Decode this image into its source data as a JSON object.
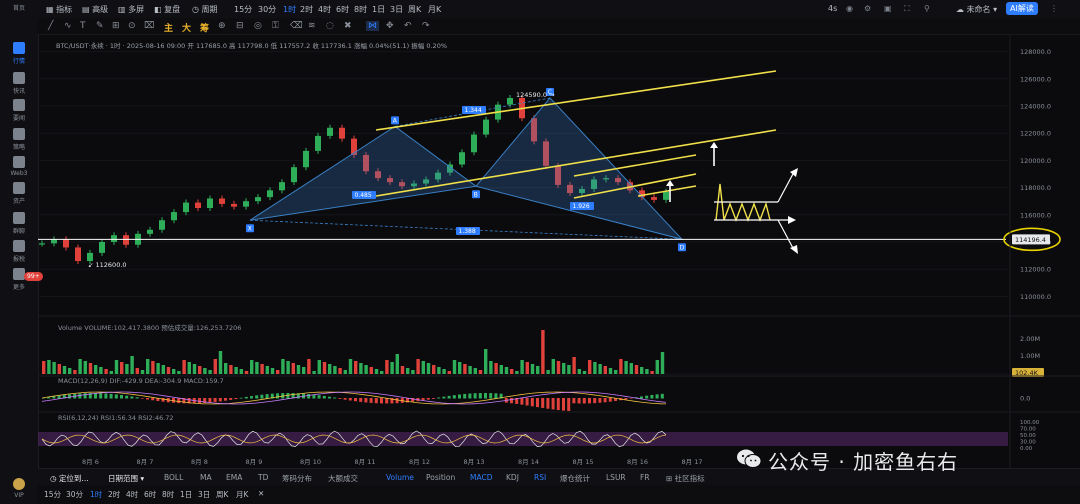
{
  "sidebar": {
    "top_label": "首页",
    "items": [
      {
        "label": "行情",
        "icon": "chart-bars-icon",
        "active": true
      },
      {
        "label": "快讯",
        "icon": "newsflash-icon"
      },
      {
        "label": "要闻",
        "icon": "news-icon"
      },
      {
        "label": "策略",
        "icon": "strategy-icon"
      },
      {
        "label": "Web3",
        "icon": "web3-icon"
      },
      {
        "label": "资产",
        "icon": "wallet-icon"
      },
      {
        "label": "群聊",
        "icon": "chat-icon"
      },
      {
        "label": "报税",
        "icon": "tax-icon"
      },
      {
        "label": "更多",
        "icon": "more-grid-icon"
      }
    ],
    "badge": "99+",
    "bottom_label": "VIP"
  },
  "toolbar": {
    "indicator": "指标",
    "advanced": "高级",
    "multi": "多屏",
    "replay": "复盘",
    "period": "周期",
    "timeframes": [
      "15分",
      "30分",
      "1时",
      "2时",
      "4时",
      "6时",
      "8时",
      "1日",
      "3日",
      "周K",
      "月K"
    ],
    "active_tf": "1时",
    "right_4s": "4s",
    "login": "未命名",
    "ai_btn": "AI解读"
  },
  "drawbar": {
    "main": "主",
    "big": "大",
    "chou": "筹"
  },
  "chart_info": {
    "ohlc": "BTC/USDT·永续 · 1时 · 2025-08-16 09:00  开 117685.0  高 117798.0  低 117557.2  收 117736.1  涨幅 0.04%(51.1)  振幅 0.20%",
    "volume": "Volume  VOLUME:102,417.3800  预估成交量:126,253.7206",
    "macd": "MACD(12,26,9)  DIF:-429.9  DEA:-304.9  MACD:159.7",
    "rsi": "RSI(6,12,24)  RSI1:56.34  RSI2:46.72"
  },
  "chart_data": {
    "type": "line",
    "title": "BTC/USDT",
    "price_axis": [
      "128000.0",
      "126000.0",
      "124000.0",
      "122000.0",
      "120000.0",
      "118000.0",
      "116000.0",
      "114000.0",
      "112000.0",
      "110000.0"
    ],
    "ylim": [
      109000,
      129000
    ],
    "current_price_tag": "114196.4",
    "high_label": "124590.0",
    "low_label": "112600.0",
    "harmonic_points": {
      "X": "X",
      "A": "A",
      "B": "B",
      "C": "C",
      "D": "D"
    },
    "ratio_labels": [
      "1.344",
      "0.485",
      "1.926",
      "1.388"
    ],
    "x_dates": [
      "8月 6",
      "8月 7",
      "8月 8",
      "8月 9",
      "8月 10",
      "8月 11",
      "8月 12",
      "8月 13",
      "8月 14",
      "8月 15",
      "8月 16",
      "8月 17"
    ],
    "price_series": [
      113900,
      114200,
      113600,
      112600,
      113200,
      114000,
      114500,
      113800,
      114600,
      114900,
      115600,
      116200,
      116900,
      116500,
      117200,
      116800,
      116600,
      117000,
      117300,
      117800,
      118400,
      119500,
      120700,
      121800,
      122400,
      121600,
      120400,
      119200,
      118700,
      118400,
      118100,
      118300,
      118600,
      119100,
      119700,
      120600,
      121900,
      123000,
      124100,
      124590,
      123100,
      121400,
      119600,
      118200,
      117600,
      117900,
      118600,
      118700,
      118400,
      117800,
      117300,
      117100,
      117700
    ],
    "volume_axis": [
      "2.00M",
      "1.00M"
    ],
    "volume_tag": "102.4K",
    "macd_axis": [
      "0.0"
    ],
    "rsi_axis": [
      "100.00",
      "70.00",
      "50.00",
      "30.00",
      "0.00"
    ]
  },
  "bottom": {
    "locate": "定位到...",
    "range": "日期范围",
    "indicators": [
      "BOLL",
      "MA",
      "EMA",
      "TD",
      "筹码分布",
      "大额成交",
      "Volume",
      "Position",
      "MACD",
      "KDJ",
      "RSI",
      "爆仓统计",
      "LSUR",
      "FR",
      "社区指标"
    ],
    "active_indicators": [
      "Volume",
      "MACD",
      "RSI"
    ],
    "timeframes": [
      "15分",
      "30分",
      "1时",
      "2时",
      "4时",
      "6时",
      "8时",
      "1日",
      "3日",
      "周K",
      "月K"
    ],
    "active_tf": "1时",
    "close": "✕"
  },
  "watermark": "公众号 · 加密鱼右右",
  "colors": {
    "up": "#2fae5a",
    "down": "#e0413a",
    "accent": "#2f7dff",
    "channel": "#f0e04a",
    "pattern": "#3a7fc4"
  }
}
